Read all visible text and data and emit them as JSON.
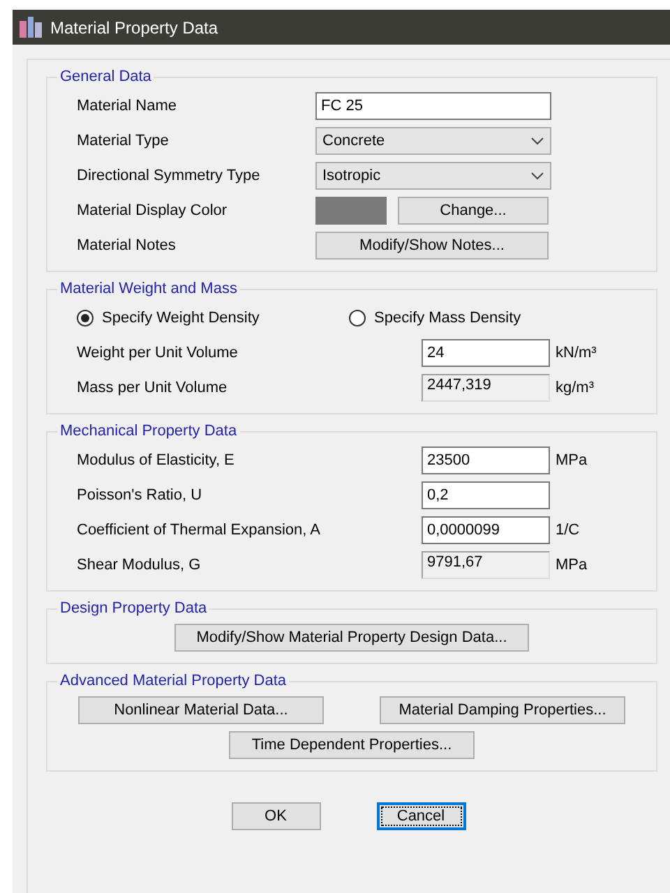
{
  "window": {
    "title": "Material Property Data"
  },
  "sections": [
    {
      "title": "General Data",
      "rows": [
        {
          "kind": "text",
          "label": "Material Name",
          "value": "FC 25"
        },
        {
          "kind": "select",
          "label": "Material Type",
          "value": "Concrete"
        },
        {
          "kind": "select",
          "label": "Directional Symmetry Type",
          "value": "Isotropic"
        },
        {
          "kind": "color",
          "label": "Material Display Color",
          "color": "#7a7a7a",
          "button": "Change..."
        },
        {
          "kind": "button",
          "label": "Material Notes",
          "button": "Modify/Show Notes..."
        }
      ]
    },
    {
      "title": "Material Weight and Mass",
      "rows": [
        {
          "kind": "radios",
          "options": [
            {
              "label": "Specify Weight Density",
              "selected": true
            },
            {
              "label": "Specify Mass Density",
              "selected": false
            }
          ]
        },
        {
          "kind": "number",
          "label": "Weight per Unit Volume",
          "value": "24",
          "unit": "kN/m³",
          "readonly": false
        },
        {
          "kind": "number",
          "label": "Mass per Unit Volume",
          "value": "2447,319",
          "unit": "kg/m³",
          "readonly": true
        }
      ]
    },
    {
      "title": "Mechanical Property Data",
      "rows": [
        {
          "kind": "number",
          "label": "Modulus of Elasticity,  E",
          "value": "23500",
          "unit": "MPa",
          "readonly": false
        },
        {
          "kind": "number",
          "label": "Poisson's Ratio,  U",
          "value": "0,2",
          "readonly": false
        },
        {
          "kind": "number",
          "label": "Coefficient of Thermal Expansion,  A",
          "value": "0,0000099",
          "unit": "1/C",
          "readonly": false
        },
        {
          "kind": "number",
          "label": "Shear Modulus,  G",
          "value": "9791,67",
          "unit": "MPa",
          "readonly": true
        }
      ]
    },
    {
      "title": "Design Property Data",
      "rows": [
        {
          "kind": "buttons",
          "buttons": [
            "Modify/Show Material Property Design Data..."
          ]
        }
      ]
    },
    {
      "title": "Advanced Material Property Data",
      "rows": [
        {
          "kind": "buttons",
          "buttons": [
            "Nonlinear Material Data...",
            "Material Damping Properties..."
          ]
        },
        {
          "kind": "buttons",
          "buttons": [
            "Time Dependent Properties..."
          ]
        }
      ]
    }
  ],
  "buttons": [
    {
      "label": "OK",
      "focused": false
    },
    {
      "label": "Cancel",
      "focused": true
    }
  ]
}
